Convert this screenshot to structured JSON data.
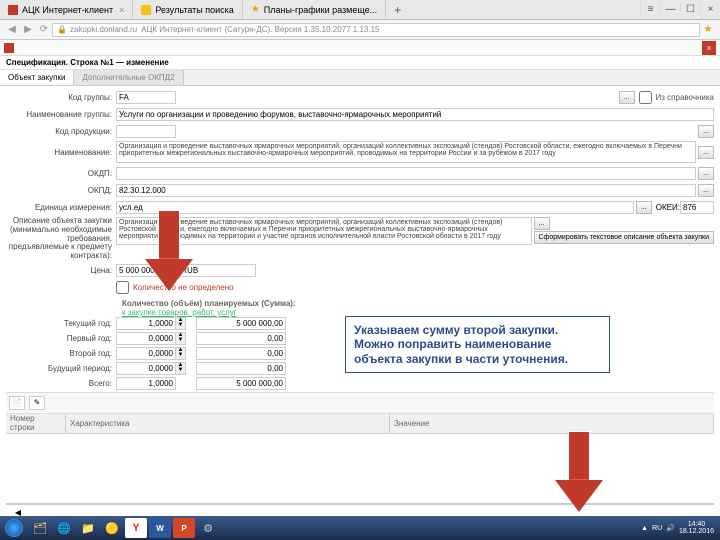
{
  "browser": {
    "tabs": [
      {
        "label": "АЦК Интернет-клиент",
        "closable": true
      },
      {
        "label": "Результаты поиска"
      },
      {
        "label": "Планы-графики размеще..."
      }
    ],
    "url_lock": "🔒",
    "url": "zakupki.donland.ru",
    "app_title": "АЦК Интернет-клиент (Сатурн-ДС). Версия 1.35.10.2077 1.13.15"
  },
  "spec_title": "Спецификация. Строка №1 — изменение",
  "tabs2": {
    "t1": "Объект закупки",
    "t2": "Дополнительные ОКПД2"
  },
  "form": {
    "kod_gruppy_label": "Код группы:",
    "kod_gruppy": "FA",
    "from_dir": "Из справочника",
    "name_group_label": "Наименование группы:",
    "name_group": "Услуги по организации и проведению форумов, выставочно-ярмарочных мероприятий",
    "kod_prod_label": "Код продукции:",
    "desc_label": "Наименование:",
    "desc": "Организация и проведение выставочных ярмарочных мероприятий, организаций коллективных экспозиций (стендов) Ростовской области, ежегодно включаемых в Перечни приоритетных межрегиональных выставочно-ярмарочных мероприятий, проводимых на территории России и за рубежом в 2017 году",
    "okdp_label": "ОКДП:",
    "okpd_label": "ОКПД:",
    "okpd": "82.30.12.000",
    "ei_label": "Единица измерения:",
    "ei": "усл.ед",
    "okei_lbl": "ОКЕИ:",
    "okei": "876",
    "desc2_label": "Описание объекта закупки (минимально необходимые требования, предъявляемые к предмету контракта):",
    "desc2": "Организация и проведение выставочных ярмарочных мероприятий, организаций коллективных экспозиций (стендов) Ростовской области, ежегодно включаемых в Перечни приоритетных межрегиональных выставочно-ярмарочных мероприятий, проводимых на территории и участие органов исполнительной власти Ростовской области в 2017 году",
    "func_btn": "Сформировать текстовое описание объекта закупки",
    "price_label": "Цена:",
    "price": "5 000 000,00000   RUB",
    "cb_values": "Количество не определено",
    "fin_hdr": "Количество (объём) планируемых (Сумма):",
    "fin_link": "к закупке товаров, работ, услуг",
    "rows": {
      "current": {
        "label": "Текущий год:",
        "qty": "1,0000",
        "sum": "5 000 000,00"
      },
      "first": {
        "label": "Первый год:",
        "qty": "0,0000",
        "sum": "0,00"
      },
      "second": {
        "label": "Второй год:",
        "qty": "0,0000",
        "sum": "0,00"
      },
      "future": {
        "label": "Будущий период:",
        "qty": "0,0000",
        "sum": "0,00"
      },
      "total": {
        "label": "Всего:",
        "qty": "1,0000",
        "sum": "5 000 000,00"
      }
    }
  },
  "grid": {
    "c1": "Номер строки",
    "c2": "Характеристика",
    "c3": "Значение"
  },
  "annotation": "Указываем сумму второй закупки. Можно поправить наименование объекта закупки в части уточнения.",
  "clock": {
    "time": "14:40",
    "date": "18.12.2016"
  },
  "tray_text": "RU"
}
